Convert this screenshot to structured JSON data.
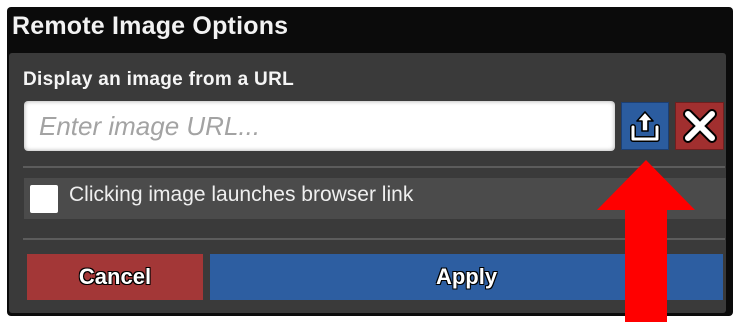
{
  "dialog": {
    "title": "Remote Image Options",
    "section_label": "Display an image from a URL",
    "url_input": {
      "value": "",
      "placeholder": "Enter image URL..."
    },
    "upload_button": {
      "icon": "upload-icon",
      "color": "#2b5c9f"
    },
    "clear_button": {
      "icon": "close-icon",
      "color": "#a12f2f"
    },
    "checkbox": {
      "label": "Clicking image launches browser link",
      "checked": false
    },
    "cancel_label": "Cancel",
    "apply_label": "Apply"
  },
  "annotation": {
    "icon": "red-arrow-pointing-up",
    "color": "#ff0000"
  }
}
